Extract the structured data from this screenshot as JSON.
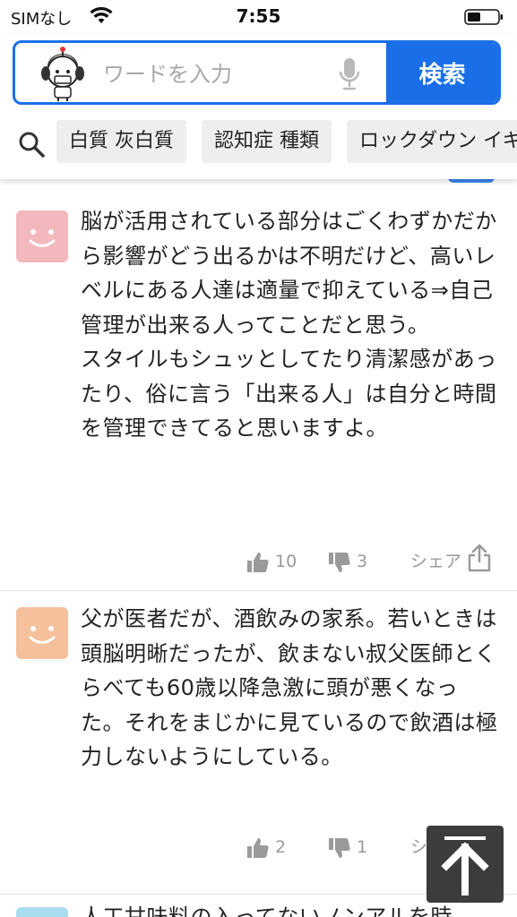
{
  "status_bar": {
    "carrier": "SIMなし",
    "time": "7:55"
  },
  "search": {
    "placeholder": "ワードを入力",
    "button_label": "検索"
  },
  "tags": [
    "白質 灰白質",
    "認知症 種類",
    "ロックダウン イギ"
  ],
  "comments": [
    {
      "avatar_color": "#f2b8bd",
      "text": "脳が活用されている部分はごくわずかだから影響がどう出るかは不明だけど、高いレベルにある人達は適量で抑えている⇒自己管理が出来る人ってことだと思う。\nスタイルもシュッとしてたり清潔感があったり、俗に言う「出来る人」は自分と時間を管理できてると思いますよ。",
      "likes": "10",
      "dislikes": "3",
      "share_label": "シェア"
    },
    {
      "avatar_color": "#f4c19c",
      "text": "父が医者だが、酒飲みの家系。若いときは頭脳明晰だったが、飲まない叔父医師とくらべても60歳以降急激に頭が悪くなった。それをまじかに見ているので飲酒は極力しないようにしている。",
      "likes": "2",
      "dislikes": "1",
      "share_label": "シェア"
    },
    {
      "avatar_color": "#a9dcef",
      "text": "人工甘味料の入ってないノンアルを時"
    }
  ],
  "icons": {
    "wifi": "wifi-icon",
    "battery": "battery-icon",
    "mascot": "mascot-icon",
    "mic": "microphone-icon",
    "search": "search-icon",
    "like": "thumbs-up-icon",
    "dislike": "thumbs-down-icon",
    "share": "share-icon",
    "scroll_top": "arrow-up-icon"
  },
  "colors": {
    "accent": "#1a6fe8"
  }
}
